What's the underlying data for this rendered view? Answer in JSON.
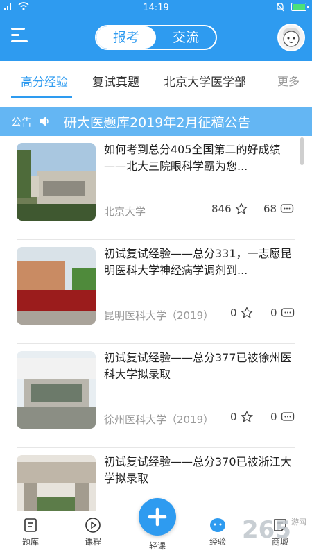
{
  "status_bar": {
    "time": "14:19"
  },
  "header": {
    "segments": [
      "报考",
      "交流"
    ],
    "active_segment": "报考"
  },
  "tabs": [
    "高分经验",
    "复试真题",
    "北京大学医学部"
  ],
  "tabs_more": "更多",
  "notice": {
    "label": "公告",
    "text": "研大医题库2019年2月征稿公告"
  },
  "articles": [
    {
      "title": "如何考到总分405全国第二的好成绩——北大三院眼科学霸为您...",
      "source": "北京大学",
      "favorites": "846",
      "comments": "68"
    },
    {
      "title": "初试复试经验——总分331，一志愿昆明医科大学神经病学调剂到...",
      "source": "昆明医科大学（2019）",
      "favorites": "0",
      "comments": "0"
    },
    {
      "title": "初试复试经验——总分377已被徐州医科大学拟录取",
      "source": "徐州医科大学（2019）",
      "favorites": "0",
      "comments": "0"
    },
    {
      "title": "初试复试经验——总分370已被浙江大学拟录取",
      "source": "",
      "favorites": "",
      "comments": ""
    }
  ],
  "bottom_nav": [
    "题库",
    "课程",
    "轻课",
    "经验",
    "商城"
  ],
  "watermark": {
    "text": "265",
    "suffix": "游网"
  },
  "colors": {
    "primary": "#2e9bf0",
    "notice_bg": "#64b6f3"
  }
}
